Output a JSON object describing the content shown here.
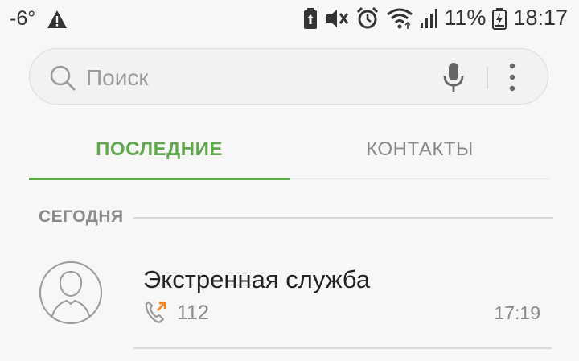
{
  "status_bar": {
    "temperature": "-6°",
    "battery_percent": "11%",
    "clock": "18:17",
    "icons": [
      "warning-icon",
      "battery-saver-icon",
      "vibrate-mute-icon",
      "alarm-icon",
      "wifi-icon",
      "signal-icon",
      "battery-charging-icon"
    ]
  },
  "search": {
    "placeholder": "Поиск",
    "icons": [
      "search-icon",
      "microphone-icon",
      "more-options-icon"
    ]
  },
  "tabs": [
    {
      "label": "ПОСЛЕДНИЕ",
      "selected": true
    },
    {
      "label": "КОНТАКТЫ",
      "selected": false
    }
  ],
  "sections": [
    {
      "label": "СЕГОДНЯ",
      "calls": [
        {
          "name": "Экстренная служба",
          "number": "112",
          "time": "17:19",
          "call_type": "outgoing-call-icon"
        }
      ]
    }
  ],
  "colors": {
    "accent": "#5fa84c",
    "outgoing_arrow": "#f0841f"
  }
}
